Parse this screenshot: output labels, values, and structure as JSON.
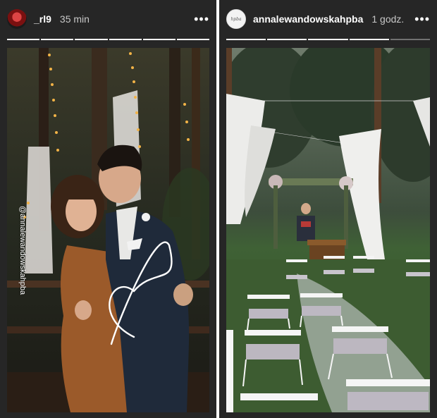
{
  "stories": [
    {
      "username": "_rl9",
      "timestamp": "35 min",
      "more_glyph": "•••",
      "progress_segments": 6,
      "progress_done": 6,
      "mention_sticker": "@annalewandowskahpba",
      "avatar_icon": "profile-avatar"
    },
    {
      "username": "annalewandowskahpba",
      "timestamp": "1 godz.",
      "more_glyph": "•••",
      "progress_segments": 5,
      "progress_done": 4,
      "avatar_text": "hpba",
      "avatar_icon": "brand-logo-avatar"
    }
  ],
  "colors": {
    "story_bg": "#262626",
    "text": "#ffffff",
    "subtext": "#c8c8c8"
  }
}
